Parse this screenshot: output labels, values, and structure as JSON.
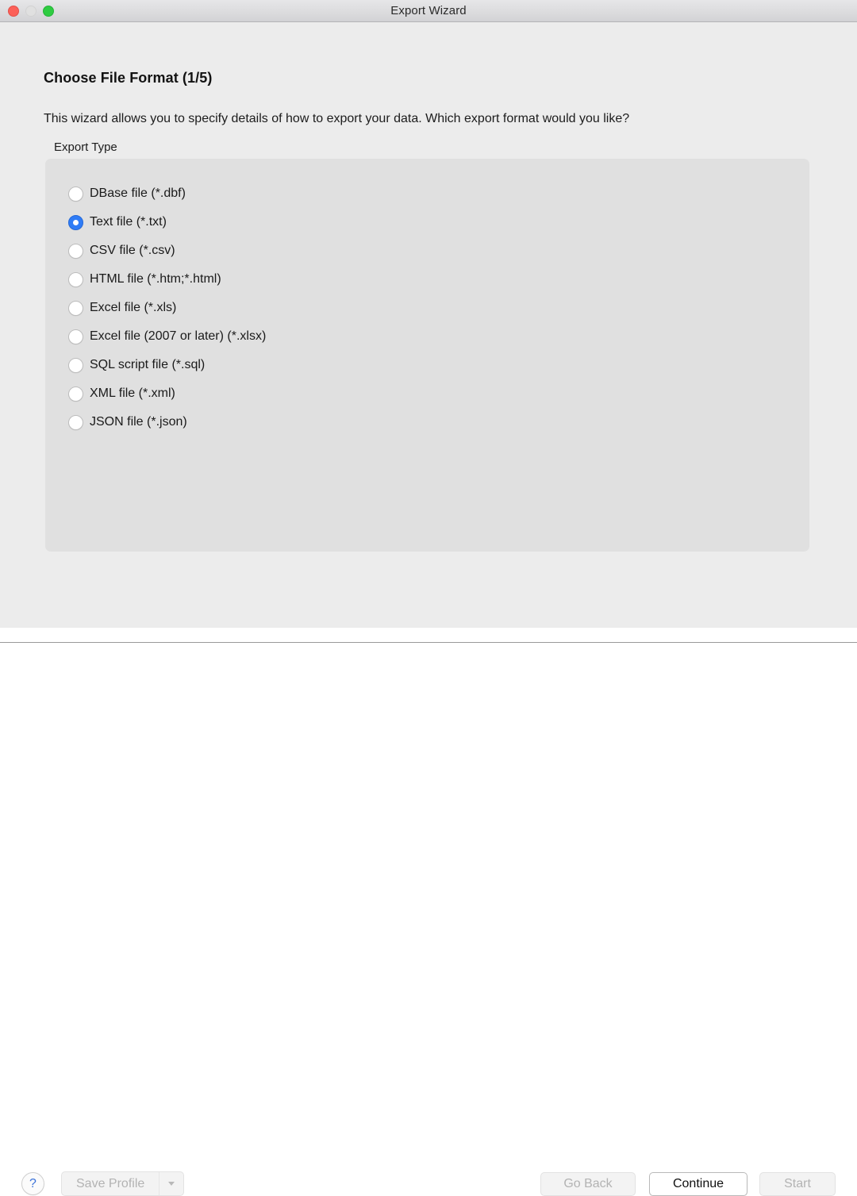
{
  "window": {
    "title": "Export Wizard",
    "traffic_lights": [
      {
        "name": "close",
        "color": "#fc6058",
        "enabled": true
      },
      {
        "name": "minimize",
        "color": "#e0e0e0",
        "enabled": false
      },
      {
        "name": "zoom",
        "color": "#2ecc41",
        "enabled": true
      }
    ]
  },
  "page": {
    "title": "Choose File Format (1/5)",
    "description": "This wizard allows you to specify details of how to export your data. Which export format would you like?",
    "step_current": 1,
    "step_total": 5
  },
  "export_type": {
    "group_label": "Export Type",
    "selected_index": 1,
    "options": [
      {
        "label": "DBase file (*.dbf)",
        "selected": false
      },
      {
        "label": "Text file (*.txt)",
        "selected": true
      },
      {
        "label": "CSV file (*.csv)",
        "selected": false
      },
      {
        "label": "HTML file (*.htm;*.html)",
        "selected": false
      },
      {
        "label": "Excel file (*.xls)",
        "selected": false
      },
      {
        "label": "Excel file (2007 or later) (*.xlsx)",
        "selected": false
      },
      {
        "label": "SQL script file (*.sql)",
        "selected": false
      },
      {
        "label": "XML file (*.xml)",
        "selected": false
      },
      {
        "label": "JSON file (*.json)",
        "selected": false
      }
    ]
  },
  "footer": {
    "help_label": "?",
    "save_profile_label": "Save Profile",
    "save_profile_enabled": false,
    "go_back_label": "Go Back",
    "go_back_enabled": false,
    "continue_label": "Continue",
    "continue_enabled": true,
    "start_label": "Start",
    "start_enabled": false
  },
  "colors": {
    "accent": "#2f7cf6",
    "window_bg": "#ececec",
    "panel_bg": "#e0e0e0",
    "help_glyph": "#3b72d9",
    "disabled_text": "#b3b3b3"
  }
}
